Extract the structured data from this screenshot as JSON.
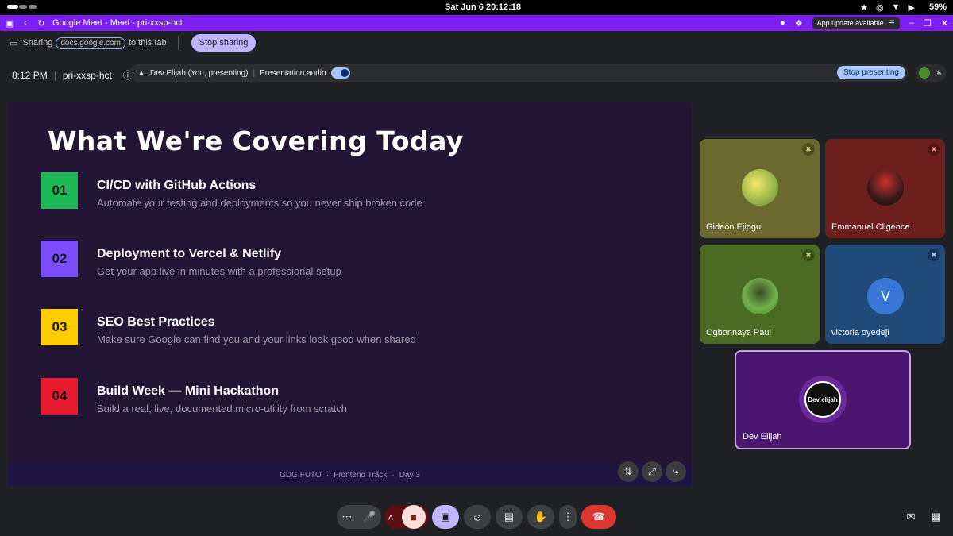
{
  "statusbar": {
    "datetime": "Sat Jun 6  20:12:18",
    "battery": "59%"
  },
  "browser": {
    "tab_title": "Google Meet - Meet - pri-xxsp-hct",
    "update_label": "App update available"
  },
  "sharebar": {
    "sharing_label": "Sharing",
    "domain": "docs.google.com",
    "suffix": "to this tab",
    "stop_label": "Stop sharing"
  },
  "meeting": {
    "time": "8:12 PM",
    "code": "pri-xxsp-hct",
    "presenter_label": "Dev Elijah (You, presenting)",
    "audio_label": "Presentation audio",
    "stop_presenting_label": "Stop presenting",
    "participant_count": "6"
  },
  "slide": {
    "title": "What We're Covering Today",
    "items": [
      {
        "num": "01",
        "title": "CI/CD with GitHub Actions",
        "sub": "Automate your testing and deployments so you never ship broken code",
        "color": "#1db954"
      },
      {
        "num": "02",
        "title": "Deployment to Vercel & Netlify",
        "sub": "Get your app live in minutes with a professional setup",
        "color": "#7c4dff"
      },
      {
        "num": "03",
        "title": "SEO Best Practices",
        "sub": "Make sure Google can find you and your links look good when shared",
        "color": "#ffcc00"
      },
      {
        "num": "04",
        "title": "Build Week — Mini Hackathon",
        "sub": "Build a real, live, documented micro-utility from scratch",
        "color": "#e8192c"
      }
    ],
    "footer": [
      "GDG FUTO",
      "·",
      "Frontend Track",
      "·",
      "Day 3"
    ]
  },
  "participants": [
    {
      "name": "Gideon Ejiogu",
      "bg": "#6b6a2e",
      "mic": "muted"
    },
    {
      "name": "Emmanuel Cligence",
      "bg": "#6d1f1c",
      "mic": "muted"
    },
    {
      "name": "Ogbonnaya Paul",
      "bg": "#4c6b22",
      "mic": "muted"
    },
    {
      "name": "victoria oyedeji",
      "initial": "V",
      "bg": "#1f4a7a",
      "mic": "muted"
    },
    {
      "name": "Dev Elijah",
      "logo": "Dev elijah",
      "bg": "#4a1670"
    }
  ]
}
